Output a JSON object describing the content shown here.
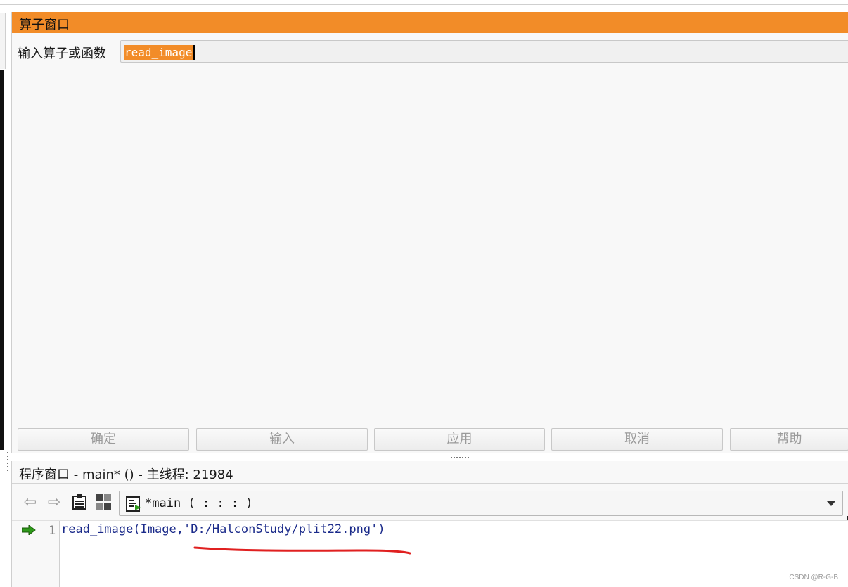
{
  "operator_window": {
    "title": "算子窗口",
    "input_label": "输入算子或函数",
    "input_value": "read_image",
    "buttons": [
      "确定",
      "输入",
      "应用",
      "取消",
      "帮助"
    ]
  },
  "program_window": {
    "title": "程序窗口 - main* () - 主线程: 21984",
    "procedure_select": "*main ( : : : )",
    "line_number": "1",
    "code_line": "read_image(Image,'D:/HalconStudy/plit22.png')"
  },
  "colors": {
    "accent_orange": "#f28c28",
    "code_blue": "#1a2a8a",
    "annotation_red": "#e02020",
    "pc_arrow_green": "#2e9a1a"
  },
  "watermark": "CSDN @R-G-B"
}
